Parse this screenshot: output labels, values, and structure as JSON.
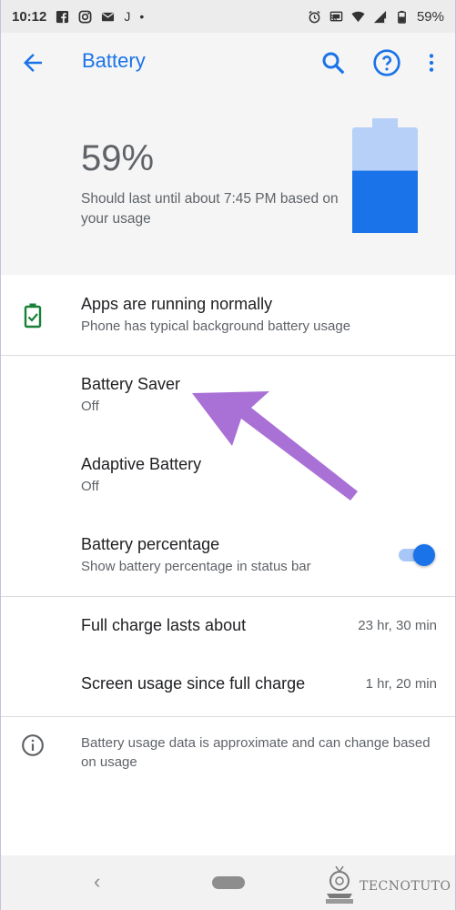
{
  "status_bar": {
    "time": "10:12",
    "left_icons": [
      "facebook-icon",
      "instagram-icon",
      "mail-icon",
      "j-icon",
      "dot-icon"
    ],
    "right_icons": [
      "alarm-icon",
      "cast-icon",
      "wifi-icon",
      "signal-icon",
      "battery-icon"
    ],
    "battery_text": "59%"
  },
  "app_bar": {
    "title": "Battery",
    "accent_color": "#1a73e8",
    "actions": [
      "back-arrow-icon",
      "search-icon",
      "help-icon",
      "more-vert-icon"
    ]
  },
  "header": {
    "percent": "59%",
    "estimate": "Should last until about 7:45 PM based on your usage",
    "level_fraction": 0.59
  },
  "status_row": {
    "title": "Apps are running normally",
    "subtitle": "Phone has typical background battery usage",
    "icon": "battery-check-icon"
  },
  "settings": {
    "battery_saver": {
      "title": "Battery Saver",
      "subtitle": "Off"
    },
    "adaptive_battery": {
      "title": "Adaptive Battery",
      "subtitle": "Off"
    },
    "battery_percentage": {
      "title": "Battery percentage",
      "subtitle": "Show battery percentage in status bar",
      "enabled": true
    }
  },
  "usage": {
    "full_charge": {
      "label": "Full charge lasts about",
      "value": "23 hr, 30 min"
    },
    "screen_usage": {
      "label": "Screen usage since full charge",
      "value": "1 hr, 20 min"
    }
  },
  "footer_note": {
    "text": "Battery usage data is approximate and can change based on usage",
    "icon": "info-icon"
  },
  "nav_bar": {
    "back_glyph": "‹",
    "watermark": "TECNOTUTO"
  },
  "annotation": {
    "color": "#a970d6"
  }
}
